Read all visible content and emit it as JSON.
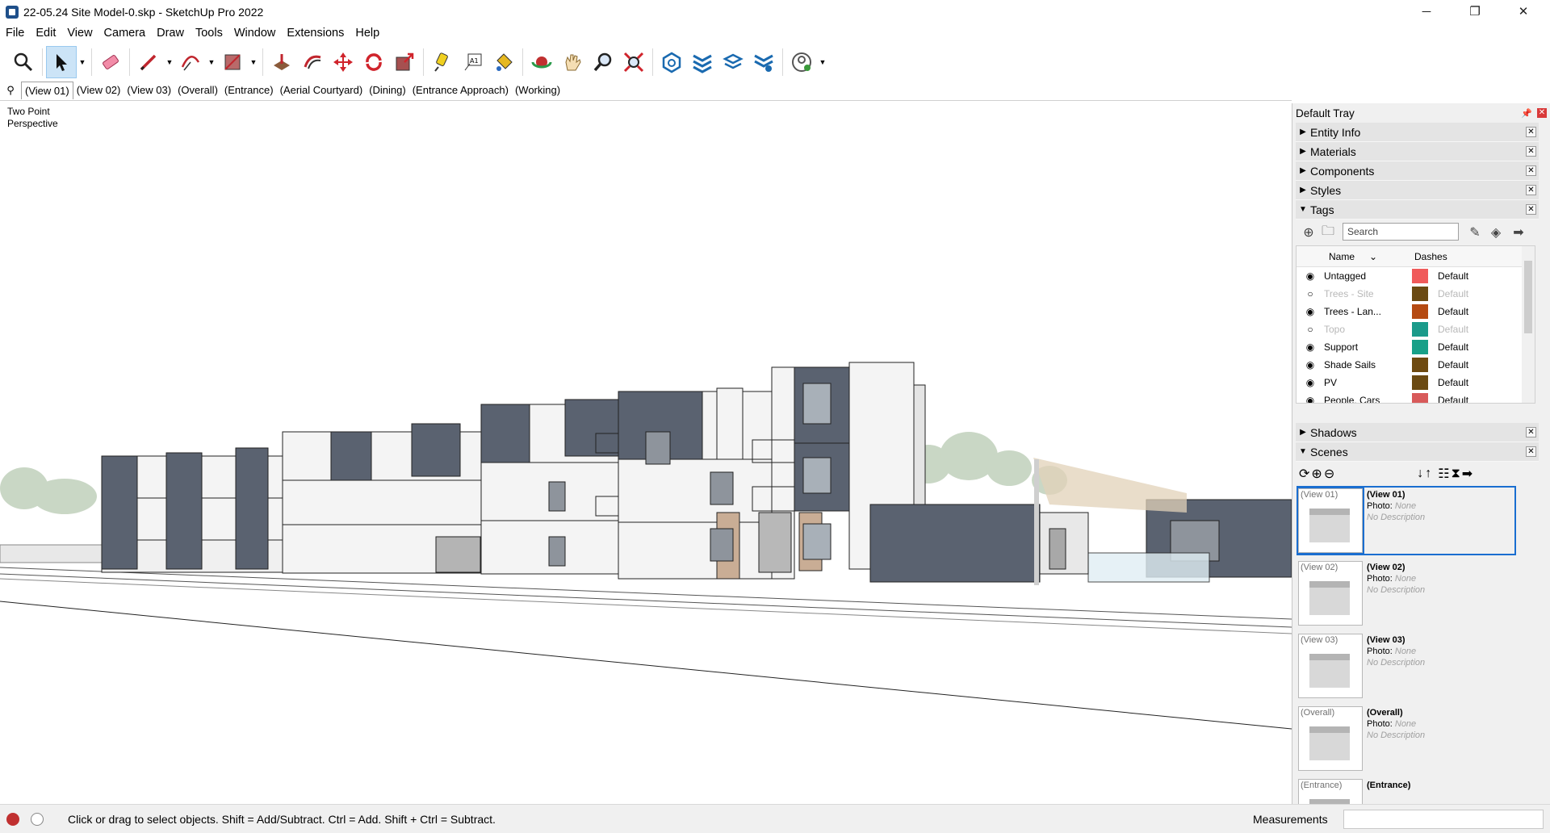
{
  "window": {
    "title": "22-05.24 Site Model-0.skp - SketchUp Pro 2022",
    "minimize": "─",
    "maximize": "❐",
    "close": "✕"
  },
  "menu": [
    "File",
    "Edit",
    "View",
    "Camera",
    "Draw",
    "Tools",
    "Window",
    "Extensions",
    "Help"
  ],
  "toolbar": {
    "tools": [
      "zoom-extents",
      "select",
      "eraser",
      "pencil-line",
      "arc",
      "rectangle",
      "push-pull",
      "offset",
      "move",
      "rotate",
      "scale",
      "tape-measure",
      "text",
      "paint-bucket",
      "orbit",
      "pan",
      "zoom",
      "zoom-window",
      "component",
      "layers",
      "stack",
      "settings",
      "profile"
    ]
  },
  "scene_tabs": {
    "tabs": [
      "(View 01)",
      "(View 02)",
      "(View 03)",
      "(Overall)",
      "(Entrance)",
      "(Aerial Courtyard)",
      "(Dining)",
      "(Entrance Approach)",
      "(Working)"
    ],
    "active": "(View 01)"
  },
  "viewport": {
    "camera_line1": "Two Point",
    "camera_line2": "Perspective"
  },
  "tray": {
    "title": "Default Tray",
    "panels": {
      "entity_info": "Entity Info",
      "materials": "Materials",
      "components": "Components",
      "styles": "Styles",
      "tags": "Tags",
      "shadows": "Shadows",
      "scenes": "Scenes"
    }
  },
  "tags": {
    "search_placeholder": "Search",
    "col_name": "Name",
    "col_dashes": "Dashes",
    "rows": [
      {
        "name": "Untagged",
        "visible": true,
        "color": "#f05a5a",
        "dash": "Default"
      },
      {
        "name": "Trees - Site",
        "visible": false,
        "color": "#6b4a12",
        "dash": "Default"
      },
      {
        "name": "Trees - Lan...",
        "visible": true,
        "color": "#b54a12",
        "dash": "Default"
      },
      {
        "name": "Topo",
        "visible": false,
        "color": "#1a9a8a",
        "dash": "Default"
      },
      {
        "name": "Support",
        "visible": true,
        "color": "#18a088",
        "dash": "Default"
      },
      {
        "name": "Shade Sails",
        "visible": true,
        "color": "#6e4a10",
        "dash": "Default"
      },
      {
        "name": "PV",
        "visible": true,
        "color": "#6b4a12",
        "dash": "Default"
      },
      {
        "name": "People, Cars",
        "visible": true,
        "color": "#d85a5a",
        "dash": "Default"
      }
    ]
  },
  "scenes": {
    "items": [
      {
        "label": "(View 01)",
        "name": "(View 01)",
        "photo_label": "Photo:",
        "photo": "None",
        "desc": "No Description",
        "selected": true
      },
      {
        "label": "(View 02)",
        "name": "(View 02)",
        "photo_label": "Photo:",
        "photo": "None",
        "desc": "No Description",
        "selected": false
      },
      {
        "label": "(View 03)",
        "name": "(View 03)",
        "photo_label": "Photo:",
        "photo": "None",
        "desc": "No Description",
        "selected": false
      },
      {
        "label": "(Overall)",
        "name": "(Overall)",
        "photo_label": "Photo:",
        "photo": "None",
        "desc": "No Description",
        "selected": false
      },
      {
        "label": "(Entrance)",
        "name": "(Entrance)",
        "photo_label": "",
        "photo": "",
        "desc": "",
        "selected": false
      }
    ]
  },
  "status": {
    "message": "Click or drag to select objects. Shift = Add/Subtract. Ctrl = Add. Shift + Ctrl = Subtract.",
    "measurements_label": "Measurements",
    "measurements_value": ""
  },
  "colors": {
    "accent": "#1a6ed0",
    "module_dark": "#5a6270",
    "module_white": "#f4f4f4",
    "tree": "#b5c7b0"
  }
}
